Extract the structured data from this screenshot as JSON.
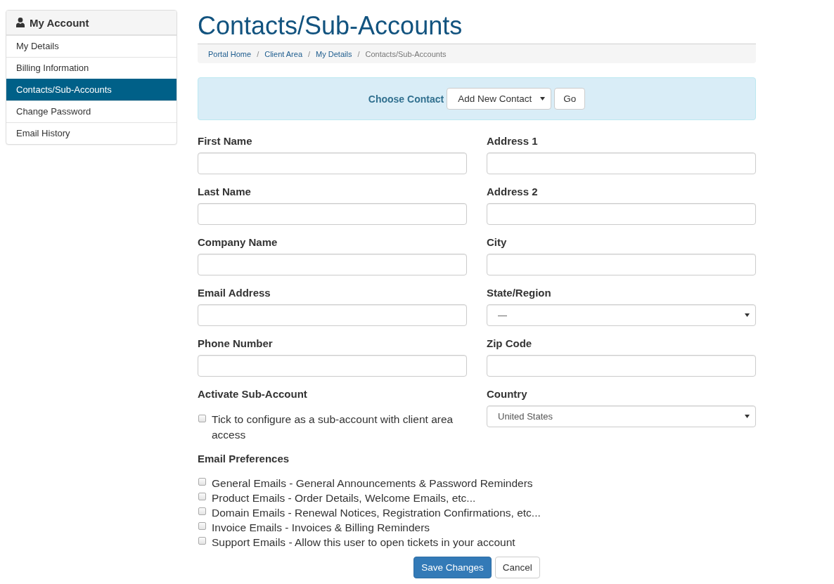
{
  "sidebar": {
    "title": "My Account",
    "items": [
      {
        "label": "My Details",
        "selected": false
      },
      {
        "label": "Billing Information",
        "selected": false
      },
      {
        "label": "Contacts/Sub-Accounts",
        "selected": true
      },
      {
        "label": "Change Password",
        "selected": false
      },
      {
        "label": "Email History",
        "selected": false
      }
    ]
  },
  "page_title": "Contacts/Sub-Accounts",
  "breadcrumb": {
    "separator": "/",
    "items": [
      {
        "label": "Portal Home",
        "current": false
      },
      {
        "label": "Client Area",
        "current": false
      },
      {
        "label": "My Details",
        "current": false
      },
      {
        "label": "Contacts/Sub-Accounts",
        "current": true
      }
    ]
  },
  "contact_chooser": {
    "label": "Choose Contact",
    "select": "Add New Contact",
    "button": "Go"
  },
  "form": {
    "left_column": [
      {
        "kind": "text",
        "label": "First Name"
      },
      {
        "kind": "text",
        "label": "Last Name"
      },
      {
        "kind": "text",
        "label": "Company Name"
      },
      {
        "kind": "text",
        "label": "Email Address"
      },
      {
        "kind": "text",
        "label": "Phone Number"
      },
      {
        "kind": "checkbox",
        "label": "Activate Sub-Account",
        "option": "Tick to configure as a sub-account with client area access",
        "checked": false
      }
    ],
    "right_column": [
      {
        "kind": "text",
        "label": "Address 1"
      },
      {
        "kind": "text",
        "label": "Address 2"
      },
      {
        "kind": "text",
        "label": "City"
      },
      {
        "kind": "select",
        "label": "State/Region",
        "value": "—"
      },
      {
        "kind": "text",
        "label": "Zip Code"
      },
      {
        "kind": "select",
        "label": "Country",
        "value": "United States"
      }
    ]
  },
  "email_preferences": {
    "title": "Email Preferences",
    "options": [
      {
        "label": "General Emails - General Announcements & Password Reminders",
        "checked": false
      },
      {
        "label": "Product Emails - Order Details, Welcome Emails, etc...",
        "checked": false
      },
      {
        "label": "Domain Emails - Renewal Notices, Registration Confirmations, etc...",
        "checked": false
      },
      {
        "label": "Invoice Emails - Invoices & Billing Reminders",
        "checked": false
      },
      {
        "label": "Support Emails - Allow this user to open tickets in your account",
        "checked": false
      }
    ]
  },
  "buttons": [
    {
      "label": "Save Changes",
      "kind": "primary"
    },
    {
      "label": "Cancel",
      "kind": "default"
    }
  ]
}
